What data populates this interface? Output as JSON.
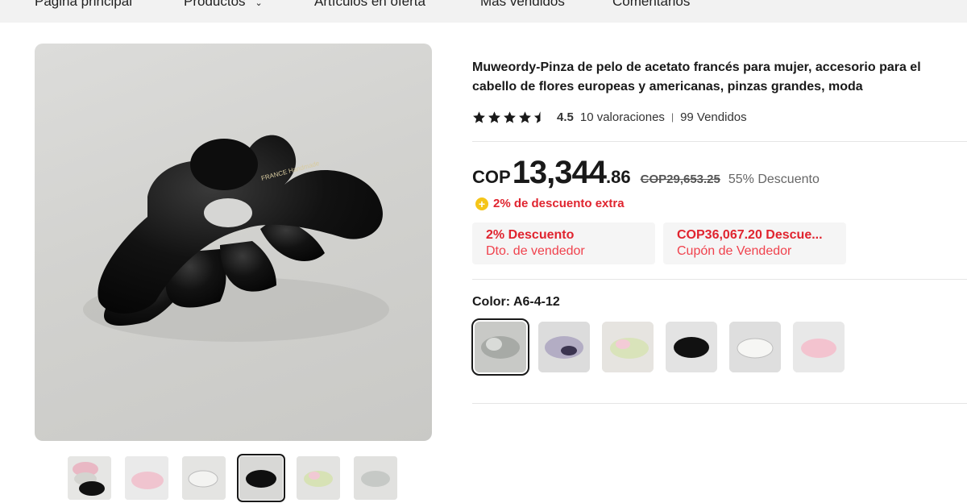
{
  "nav": {
    "items": [
      "Página principal",
      "Productos",
      "Artículos en oferta",
      "Más vendidos",
      "Comentarios"
    ],
    "products_chevron_icon": "chevron-down-icon"
  },
  "product": {
    "title": "Muweordy-Pinza de pelo de acetato francés para mujer, accesorio para el cabello de flores europeas y americanas, pinzas grandes, moda",
    "image_text": "FRANCE Handmade",
    "rating": {
      "stars": 4.5,
      "value": "4.5",
      "reviews": "10 valoraciones",
      "separator": "|",
      "sold": "99 Vendidos"
    },
    "price": {
      "currency": "COP",
      "integer": "13,344",
      "decimal": ".86",
      "old": "COP29,653.25",
      "discount": "55% Descuento"
    },
    "extra_discount": {
      "icon": "plus-coin-icon",
      "icon_glyph": "+",
      "text": "2% de descuento extra"
    },
    "coupons": [
      {
        "title": "2% Descuento",
        "subtitle": "Dto. de vendedor"
      },
      {
        "title": "COP36,067.20 Descue...",
        "subtitle": "Cupón de Vendedor"
      }
    ],
    "color": {
      "label": "Color: A6-4-12",
      "selected_index": 0,
      "swatches": [
        "clear-gray",
        "purple-marble",
        "green-pink",
        "black",
        "white-clear",
        "pink"
      ]
    },
    "thumbnails": {
      "selected_index": 3,
      "items": [
        "black-pink-white",
        "pink",
        "white-clear",
        "black",
        "green-pink",
        "clear-gray"
      ]
    }
  },
  "colors": {
    "accent_red": "#e0242f",
    "star": "#191919",
    "coin": "#f5c518"
  }
}
